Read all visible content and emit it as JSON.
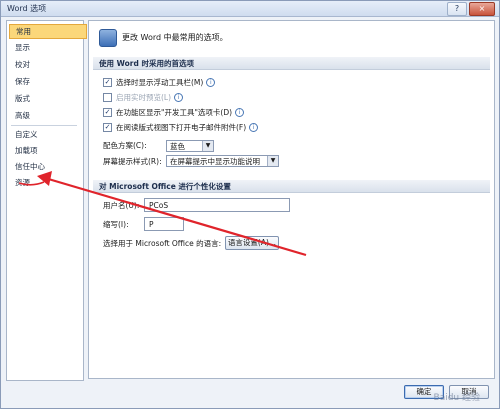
{
  "window": {
    "title": "Word 选项",
    "help_glyph": "?",
    "close_glyph": "×"
  },
  "sidebar": {
    "items": [
      {
        "label": "常用",
        "active": true
      },
      {
        "label": "显示"
      },
      {
        "label": "校对"
      },
      {
        "label": "保存"
      },
      {
        "label": "版式"
      },
      {
        "label": "高级"
      },
      {
        "label": "自定义"
      },
      {
        "label": "加载项"
      },
      {
        "label": "信任中心"
      },
      {
        "label": "资源"
      }
    ]
  },
  "content": {
    "intro": "更改 Word 中最常用的选项。",
    "section1": {
      "title": "使用 Word 时采用的首选项",
      "options": [
        {
          "label": "选择时显示浮动工具栏(M)",
          "checked": true,
          "disabled": false,
          "info": true
        },
        {
          "label": "启用实时预览(L)",
          "checked": false,
          "disabled": true,
          "info": true
        },
        {
          "label": "在功能区显示\"开发工具\"选项卡(D)",
          "checked": true,
          "disabled": false,
          "info": true
        },
        {
          "label": "在阅读版式视图下打开电子邮件附件(F)",
          "checked": true,
          "disabled": false,
          "info": true
        }
      ],
      "color_scheme_label": "配色方案(C):",
      "color_scheme_value": "蓝色",
      "screentip_label": "屏幕提示样式(R):",
      "screentip_value": "在屏幕提示中显示功能说明"
    },
    "section2": {
      "title": "对 Microsoft Office 进行个性化设置",
      "username_label": "用户名(U):",
      "username_value": "PCoS",
      "initials_label": "缩写(I):",
      "initials_value": "P",
      "language_label": "选择用于 Microsoft Office 的语言:",
      "language_button": "语言设置(A)..."
    }
  },
  "footer": {
    "ok_label": "确定",
    "cancel_label": "取消"
  },
  "watermark": "Baidu 经验",
  "colors": {
    "active_item": "#fbd77a",
    "annotation": "#e0242b"
  }
}
